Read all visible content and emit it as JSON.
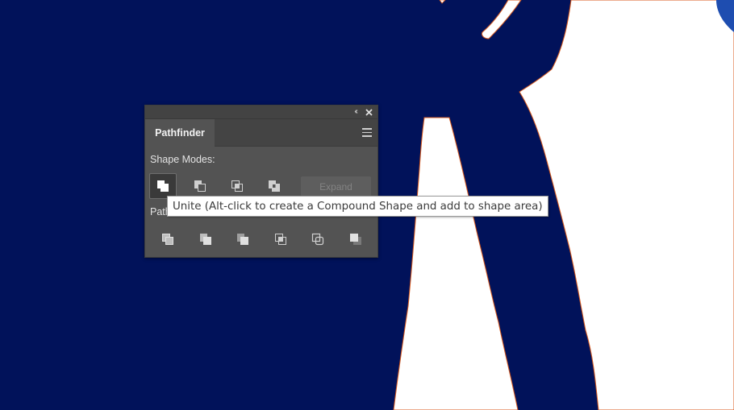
{
  "colors": {
    "artboard_background": "#01125a",
    "shape_fill": "#ffffff",
    "shape_stroke": "#d8591d",
    "panel_background": "#535353"
  },
  "panel": {
    "title": "Pathfinder",
    "collapse_glyph": "‹‹",
    "close_icon": "close-icon",
    "menu_icon": "hamburger-menu-icon",
    "shape_modes_label": "Shape Modes:",
    "shape_modes": [
      {
        "name": "unite",
        "icon": "unite-icon",
        "active": true
      },
      {
        "name": "minus-front",
        "icon": "minus-front-icon",
        "active": false
      },
      {
        "name": "intersect",
        "icon": "intersect-icon",
        "active": false
      },
      {
        "name": "exclude",
        "icon": "exclude-icon",
        "active": false
      }
    ],
    "expand_label": "Expand",
    "expand_enabled": false,
    "pathfinders_label": "Path",
    "pathfinders": [
      {
        "name": "divide",
        "icon": "divide-icon"
      },
      {
        "name": "trim",
        "icon": "trim-icon"
      },
      {
        "name": "merge",
        "icon": "merge-icon"
      },
      {
        "name": "crop",
        "icon": "crop-icon"
      },
      {
        "name": "outline",
        "icon": "outline-icon"
      },
      {
        "name": "minus-back",
        "icon": "minus-back-icon"
      }
    ]
  },
  "tooltip": {
    "text": "Unite (Alt-click to create a Compound Shape and add to shape area)"
  }
}
